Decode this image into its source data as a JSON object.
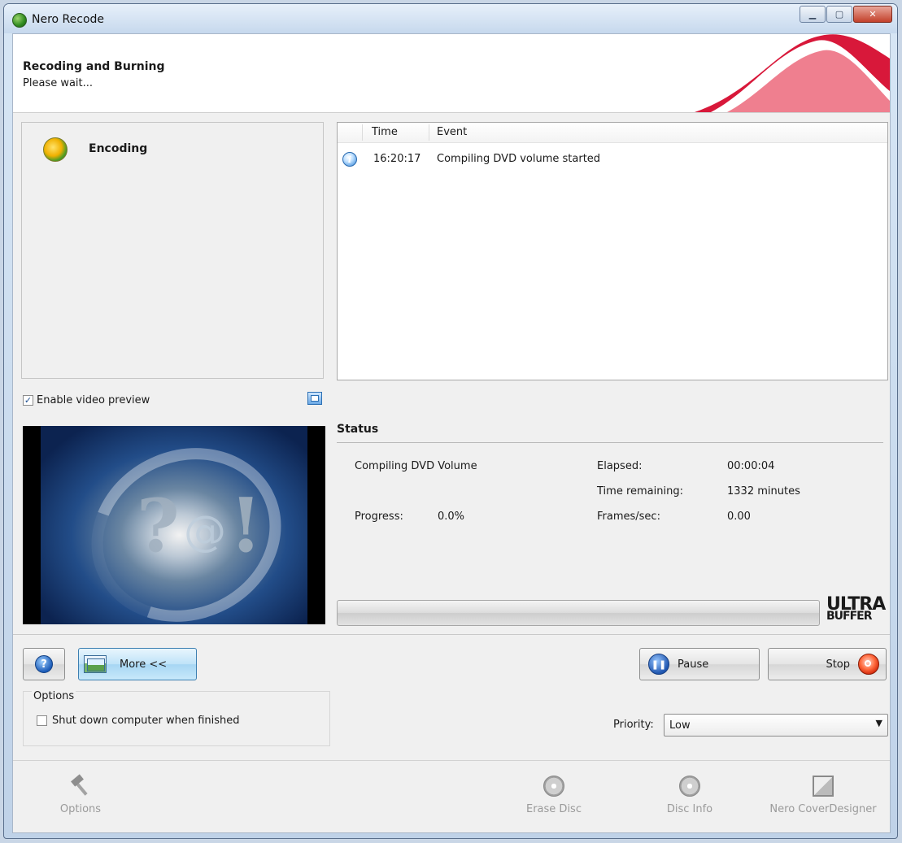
{
  "window": {
    "title": "Nero Recode"
  },
  "header": {
    "title": "Recoding and Burning",
    "subtitle": "Please wait..."
  },
  "left_panel": {
    "stage_label": "Encoding"
  },
  "events": {
    "columns": {
      "time": "Time",
      "event": "Event"
    },
    "rows": [
      {
        "time": "16:20:17",
        "event": "Compiling DVD volume started",
        "icon": "info-icon"
      }
    ]
  },
  "preview": {
    "enable_label": "Enable video preview",
    "enabled": true
  },
  "status": {
    "title": "Status",
    "operation": "Compiling DVD Volume",
    "progress_label": "Progress:",
    "progress_value": "0.0%",
    "elapsed_label": "Elapsed:",
    "elapsed_value": "00:00:04",
    "remaining_label": "Time remaining:",
    "remaining_value": "1332 minutes",
    "fps_label": "Frames/sec:",
    "fps_value": "0.00",
    "progress_fraction": 0.0,
    "logo_line1": "ULTRA",
    "logo_line2": "BUFFER"
  },
  "buttons": {
    "more": "More <<",
    "pause": "Pause",
    "stop": "Stop"
  },
  "options": {
    "title": "Options",
    "shutdown_label": "Shut down computer when finished",
    "shutdown_checked": false
  },
  "priority": {
    "label": "Priority:",
    "value": "Low"
  },
  "toolbar": {
    "options": "Options",
    "erase_disc": "Erase Disc",
    "disc_info": "Disc Info",
    "cover_designer": "Nero CoverDesigner"
  },
  "colors": {
    "accent": "#d8183a",
    "progress": "#2ea81c"
  }
}
